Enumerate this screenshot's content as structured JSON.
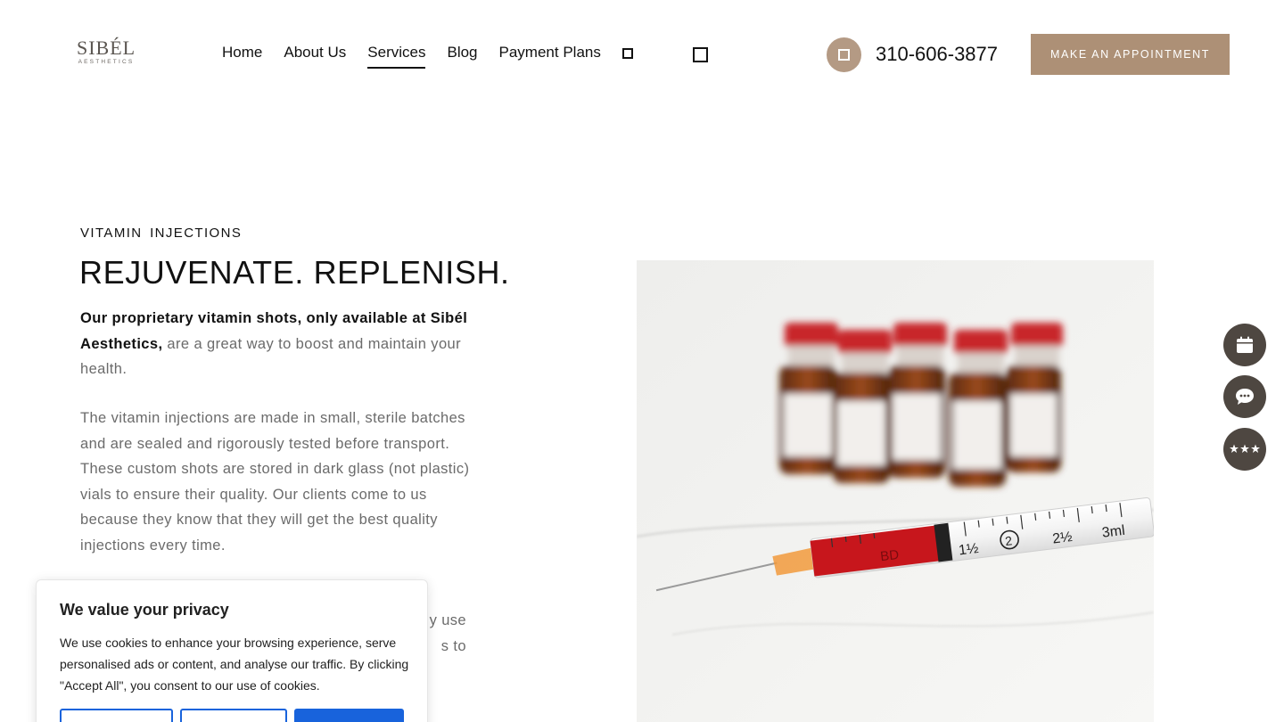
{
  "brand": {
    "logo_main": "SIBÉL",
    "logo_sub": "AESTHETICS"
  },
  "nav": {
    "items": [
      {
        "label": "Home",
        "active": false
      },
      {
        "label": "About Us",
        "active": false
      },
      {
        "label": "Services",
        "active": true
      },
      {
        "label": "Blog",
        "active": false
      },
      {
        "label": "Payment Plans",
        "active": false
      }
    ]
  },
  "contact": {
    "phone": "310-606-3877",
    "appointment_label": "MAKE AN APPOINTMENT"
  },
  "main": {
    "eyebrow": "VITAMIN  INJECTIONS",
    "headline": "REJUVENATE. REPLENISH.",
    "intro_bold": "Our proprietary vitamin shots, only available at Sibél Aesthetics,",
    "intro_rest": " are a great way to boost and maintain your health.",
    "paragraph2": "The vitamin injections are made in small, sterile batches and are sealed and rigorously tested before transport. These custom shots are stored in dark glass (not plastic) vials to ensure their quality. Our clients come to us because they know that they will get the best quality injections every time.",
    "paragraph3_line1": "y use",
    "paragraph3_line2": "s to"
  },
  "image": {
    "syringe_marks": [
      "½",
      "BD",
      "1½",
      "2",
      "2½",
      "3ml"
    ]
  },
  "floating_buttons": {
    "icons": [
      "calendar-icon",
      "chat-icon",
      "stars-icon"
    ]
  },
  "cookie_banner": {
    "title": "We value your privacy",
    "text": "We use cookies to enhance your browsing experience, serve personalised ads or content, and analyse our traffic. By clicking \"Accept All\", you consent to our use of cookies."
  },
  "colors": {
    "accent": "#ad9076",
    "fab": "#4e4741",
    "cookie_blue": "#1863dc"
  }
}
